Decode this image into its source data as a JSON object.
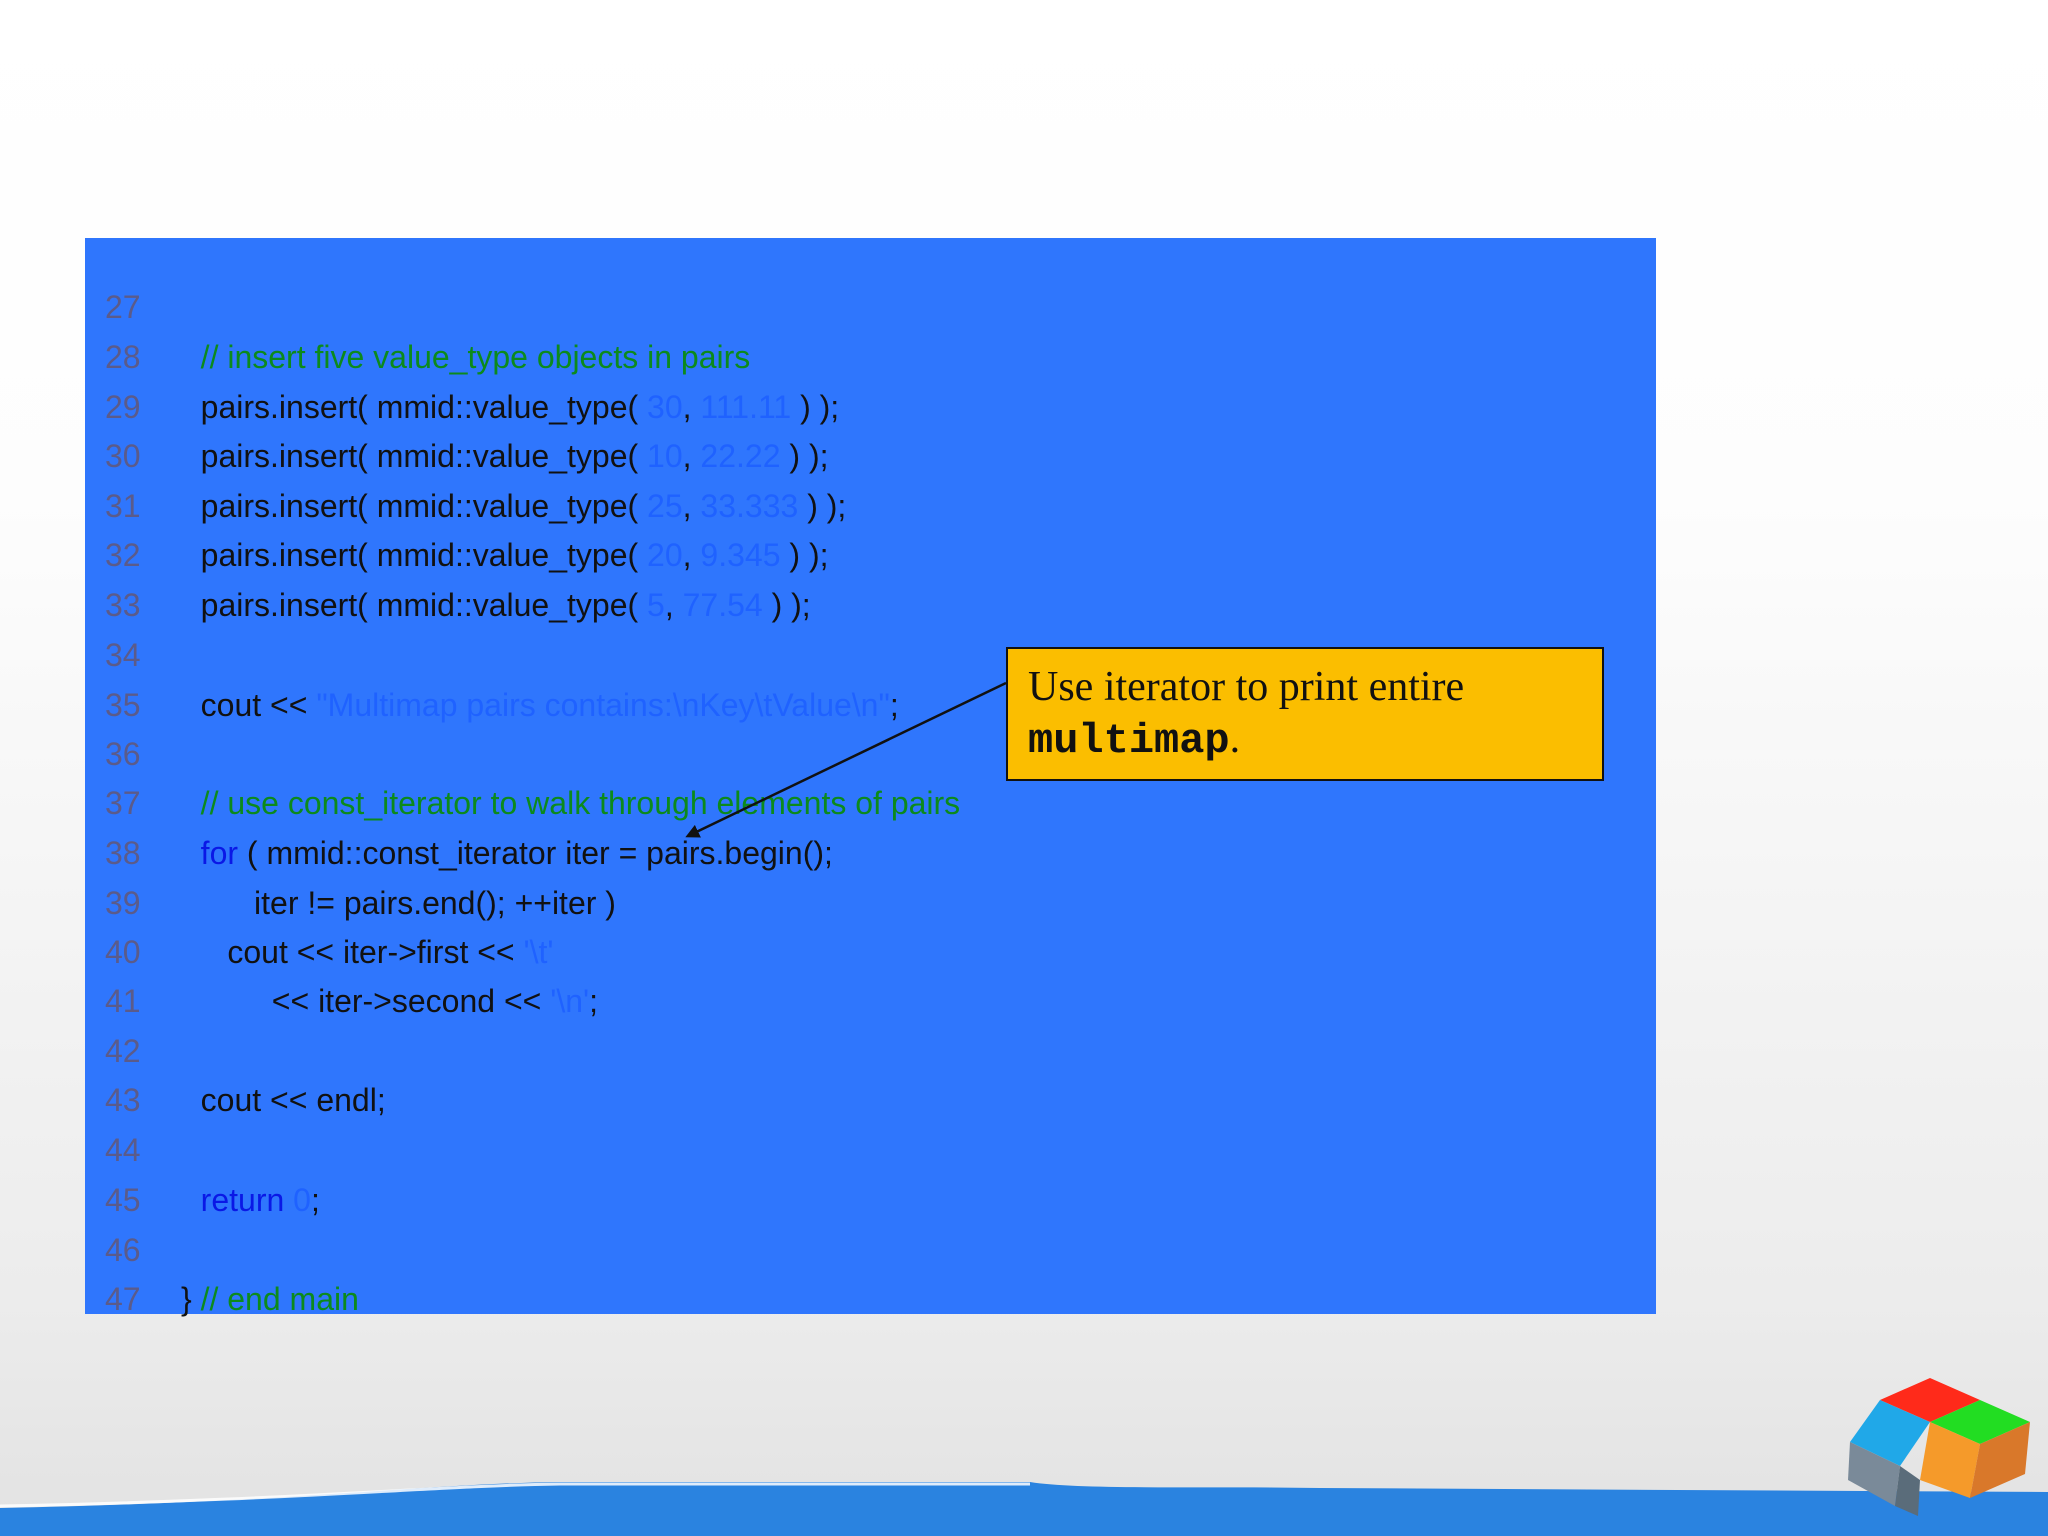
{
  "code": {
    "lines": [
      {
        "num": "27",
        "segments": []
      },
      {
        "num": "28",
        "segments": [
          {
            "text": "   // insert five value_type objects in pairs",
            "kind": "comment"
          }
        ]
      },
      {
        "num": "29",
        "segments": [
          {
            "text": "   pairs.insert( mmid::value_type( ",
            "kind": "plain"
          },
          {
            "text": "30",
            "kind": "literal"
          },
          {
            "text": ", ",
            "kind": "plain"
          },
          {
            "text": "111.11",
            "kind": "literal"
          },
          {
            "text": " ) );",
            "kind": "plain"
          }
        ]
      },
      {
        "num": "30",
        "segments": [
          {
            "text": "   pairs.insert( mmid::value_type( ",
            "kind": "plain"
          },
          {
            "text": "10",
            "kind": "literal"
          },
          {
            "text": ", ",
            "kind": "plain"
          },
          {
            "text": "22.22",
            "kind": "literal"
          },
          {
            "text": " ) );",
            "kind": "plain"
          }
        ]
      },
      {
        "num": "31",
        "segments": [
          {
            "text": "   pairs.insert( mmid::value_type( ",
            "kind": "plain"
          },
          {
            "text": "25",
            "kind": "literal"
          },
          {
            "text": ", ",
            "kind": "plain"
          },
          {
            "text": "33.333",
            "kind": "literal"
          },
          {
            "text": " ) );",
            "kind": "plain"
          }
        ]
      },
      {
        "num": "32",
        "segments": [
          {
            "text": "   pairs.insert( mmid::value_type( ",
            "kind": "plain"
          },
          {
            "text": "20",
            "kind": "literal"
          },
          {
            "text": ", ",
            "kind": "plain"
          },
          {
            "text": "9.345",
            "kind": "literal"
          },
          {
            "text": " ) );",
            "kind": "plain"
          }
        ]
      },
      {
        "num": "33",
        "segments": [
          {
            "text": "   pairs.insert( mmid::value_type( ",
            "kind": "plain"
          },
          {
            "text": "5",
            "kind": "literal"
          },
          {
            "text": ", ",
            "kind": "plain"
          },
          {
            "text": "77.54",
            "kind": "literal"
          },
          {
            "text": " ) );",
            "kind": "plain"
          }
        ]
      },
      {
        "num": "34",
        "segments": []
      },
      {
        "num": "35",
        "segments": [
          {
            "text": "   cout << ",
            "kind": "plain"
          },
          {
            "text": "\"Multimap pairs contains:\\nKey\\tValue\\n\"",
            "kind": "literal"
          },
          {
            "text": ";",
            "kind": "plain"
          }
        ]
      },
      {
        "num": "36",
        "segments": []
      },
      {
        "num": "37",
        "segments": [
          {
            "text": "   // use const_iterator to walk through elements of pairs",
            "kind": "comment"
          }
        ]
      },
      {
        "num": "38",
        "segments": [
          {
            "text": "   ",
            "kind": "plain"
          },
          {
            "text": "for",
            "kind": "keyword"
          },
          {
            "text": " ( mmid::const_iterator iter = pairs.begin();",
            "kind": "plain"
          }
        ]
      },
      {
        "num": "39",
        "segments": [
          {
            "text": "         iter != pairs.end(); ++iter )",
            "kind": "plain"
          }
        ]
      },
      {
        "num": "40",
        "segments": [
          {
            "text": "      cout << iter->first << ",
            "kind": "plain"
          },
          {
            "text": "'\\t'",
            "kind": "literal"
          }
        ]
      },
      {
        "num": "41",
        "segments": [
          {
            "text": "           << iter->second << ",
            "kind": "plain"
          },
          {
            "text": "'\\n'",
            "kind": "literal"
          },
          {
            "text": ";",
            "kind": "plain"
          }
        ]
      },
      {
        "num": "42",
        "segments": []
      },
      {
        "num": "43",
        "segments": [
          {
            "text": "   cout << endl;",
            "kind": "plain"
          }
        ]
      },
      {
        "num": "44",
        "segments": []
      },
      {
        "num": "45",
        "segments": [
          {
            "text": "   ",
            "kind": "plain"
          },
          {
            "text": "return",
            "kind": "keyword"
          },
          {
            "text": " ",
            "kind": "plain"
          },
          {
            "text": "0",
            "kind": "literal"
          },
          {
            "text": ";",
            "kind": "plain"
          }
        ]
      },
      {
        "num": "46",
        "segments": []
      },
      {
        "num": "47",
        "segments": [
          {
            "text": "} ",
            "kind": "plain"
          },
          {
            "text": "// end main",
            "kind": "comment"
          }
        ]
      }
    ]
  },
  "callout": {
    "text_prefix": "Use iterator to print entire ",
    "code_word": "multimap",
    "text_suffix": "."
  },
  "colors": {
    "panel_background": "#2f76fd",
    "callout_background": "#fbbe00",
    "comment": "#0c8a1c",
    "keyword": "#0a18e6",
    "literal": "#1f62ff",
    "line_number": "#5b5b8a"
  },
  "icons": {
    "logo": "cube-logo-icon",
    "arrow": "arrow-pointer-icon"
  }
}
